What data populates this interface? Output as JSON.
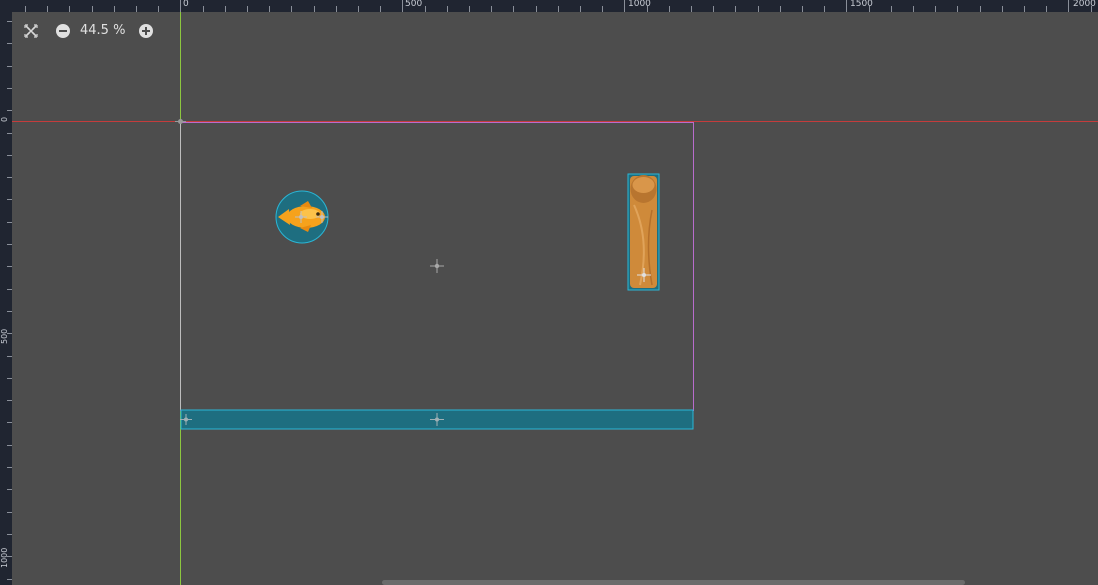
{
  "toolbar": {
    "zoom_level": "44.5 %",
    "center_view_icon": "center-view-icon",
    "zoom_out_icon": "zoom-out-icon",
    "zoom_in_icon": "zoom-in-icon"
  },
  "ruler_top": {
    "labels": [
      "0",
      "500",
      "1000",
      "1500",
      "2000"
    ]
  },
  "ruler_left": {
    "labels": [
      "0",
      "500",
      "1000"
    ]
  },
  "scene": {
    "nodes": [
      {
        "name": "player-fish",
        "type": "circle-collision"
      },
      {
        "name": "wood-pillar",
        "type": "rect-collision"
      },
      {
        "name": "floor",
        "type": "static-body"
      }
    ]
  },
  "colors": {
    "background": "#4d4d4d",
    "ruler": "#202531",
    "viewport_outline": "#b86ccd",
    "x_axis": "#c43c3c",
    "y_axis": "#8cc63f",
    "collision_fill": "#1e6e80",
    "collision_stroke": "#2ab6d6",
    "fish": "#f6a21c",
    "wood": "#d08a3a"
  }
}
